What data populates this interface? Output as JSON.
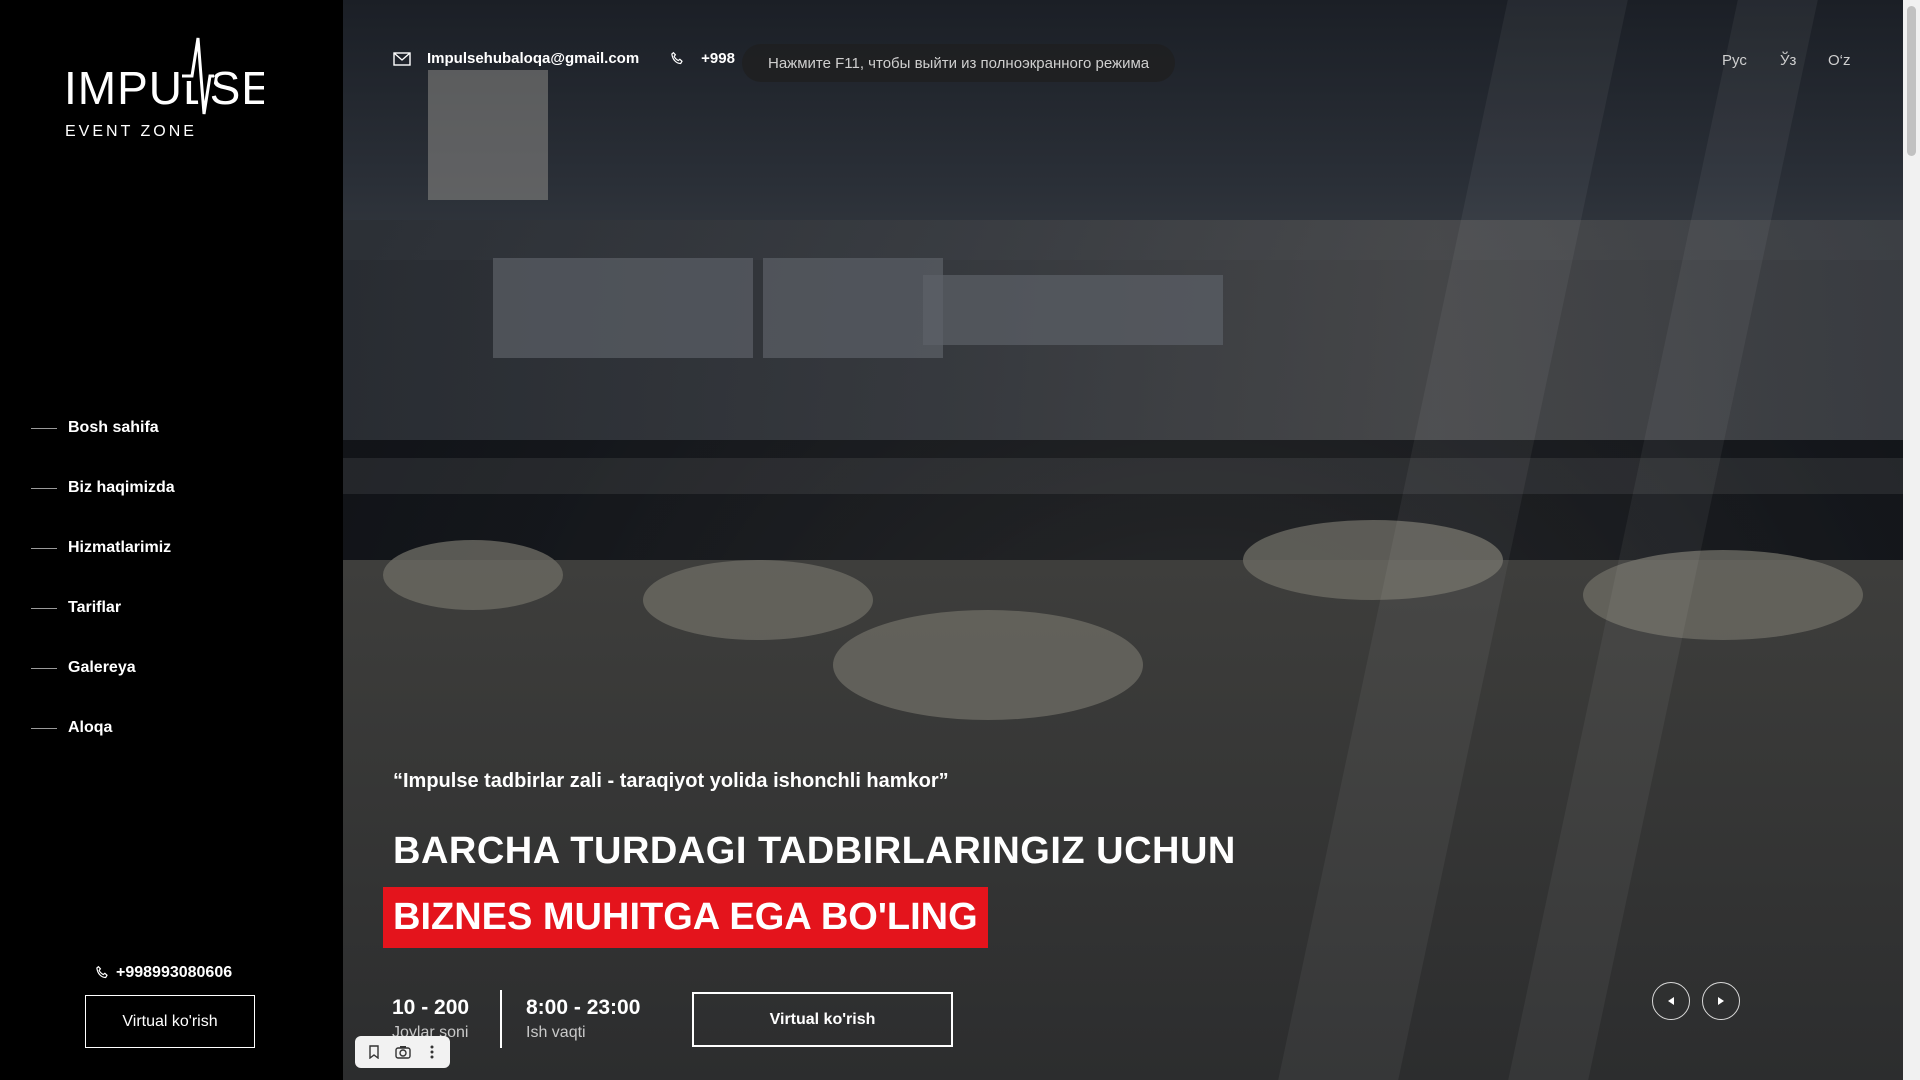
{
  "brand": {
    "logo_text": "IMPULSE",
    "logo_sub": "EVENT ZONE"
  },
  "sidebar": {
    "nav": [
      {
        "label": "Bosh sahifa"
      },
      {
        "label": "Biz haqimizda"
      },
      {
        "label": "Hizmatlarimiz"
      },
      {
        "label": "Tariflar"
      },
      {
        "label": "Galereya"
      },
      {
        "label": "Aloqa"
      }
    ],
    "phone": "+998993080606",
    "button_label": "Virtual ko'rish"
  },
  "topbar": {
    "email": "Impulsehubaloqa@gmail.com",
    "phone_prefix": "+998",
    "fullscreen_toast": "Нажмите F11, чтобы выйти из полноэкранного режима",
    "languages": [
      "Рус",
      "Ўз",
      "O‘z"
    ]
  },
  "hero": {
    "quote": "“Impulse tadbirlar zali - taraqiyot yolida ishonchli hamkor”",
    "headline_line1": "BARCHA TURDAGI TADBIRLARINGIZ UCHUN",
    "headline_line2": "BIZNES MUHITGA EGA BO'LING",
    "stats": [
      {
        "value": "10 - 200",
        "label": "Joylar soni"
      },
      {
        "value": "8:00 - 23:00",
        "label": "Ish vaqti"
      }
    ],
    "button_label": "Virtual ko'rish"
  },
  "colors": {
    "accent_red": "#e4141c",
    "sidebar_bg": "#000000"
  },
  "icons": {
    "email": "envelope-icon",
    "phone": "phone-icon",
    "prev": "chevron-left-icon",
    "next": "chevron-right-icon",
    "bookmark": "bookmark-icon",
    "camera": "camera-icon",
    "more": "more-vertical-icon"
  }
}
